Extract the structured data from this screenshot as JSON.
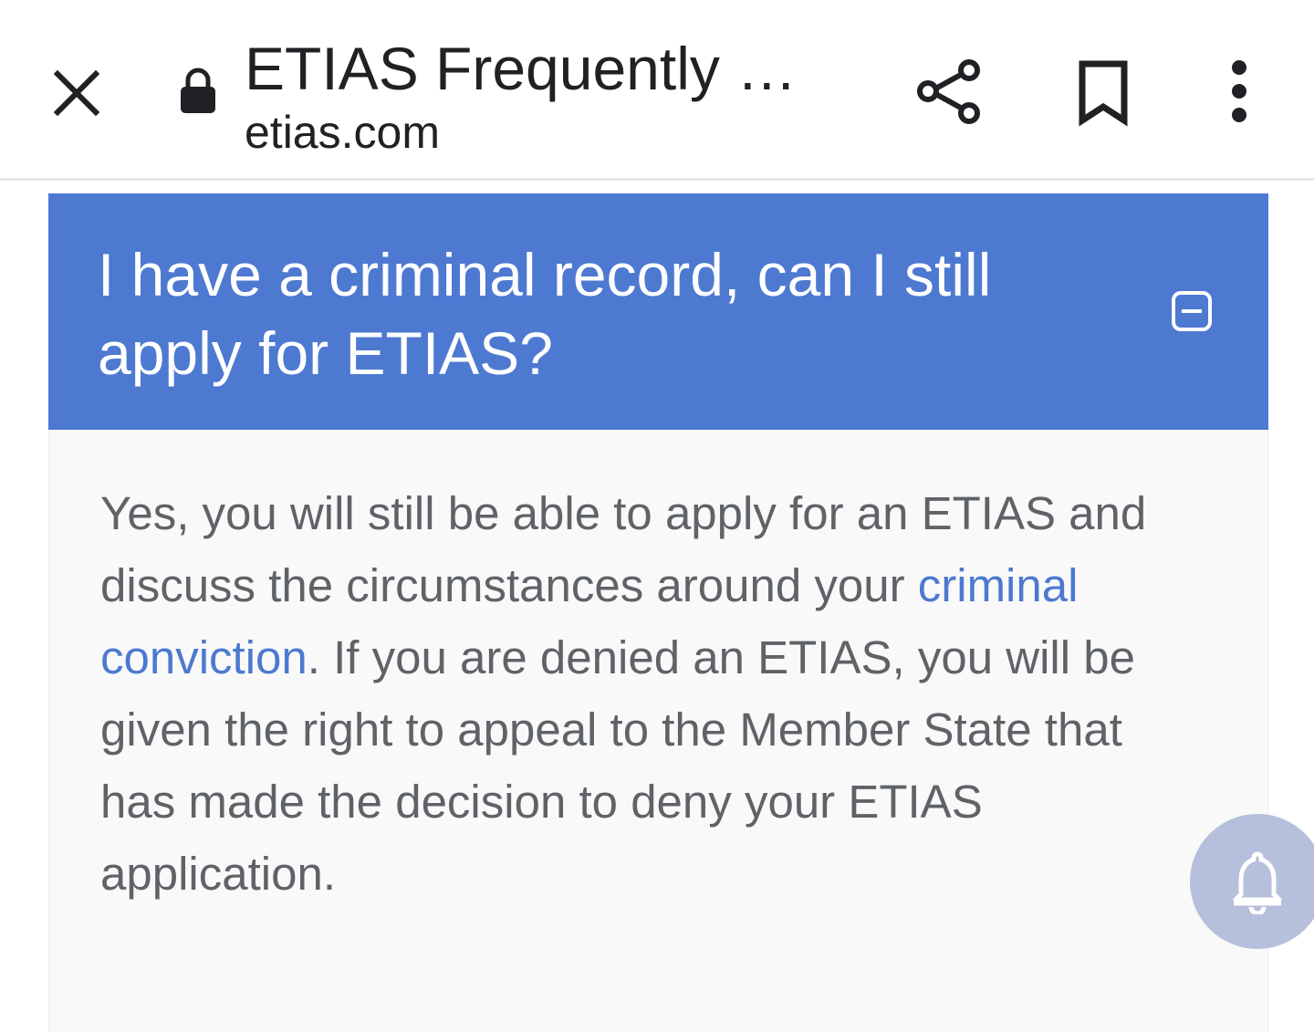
{
  "browser": {
    "page_title": "ETIAS Frequently …",
    "domain": "etias.com",
    "icons": {
      "close": "close-icon",
      "lock": "lock-icon",
      "share": "share-icon",
      "bookmark": "bookmark-icon",
      "more": "more-vert-icon"
    }
  },
  "faq": {
    "question": "I have a criminal record, can I still apply for ETIAS?",
    "answer_before_link": "Yes, you will still be able to apply for an ETIAS and discuss the circumstances around your ",
    "answer_link": "criminal conviction",
    "answer_after_link": ". If you are denied an ETIAS, you will be given the right to appeal to the Member State that has made the decision to deny your ETIAS application.",
    "collapse_icon": "minus-square-icon",
    "header_color": "#4d79d1",
    "link_color": "#4d79d1"
  },
  "fab": {
    "icon": "bell-icon",
    "color": "#b6bfdb"
  }
}
